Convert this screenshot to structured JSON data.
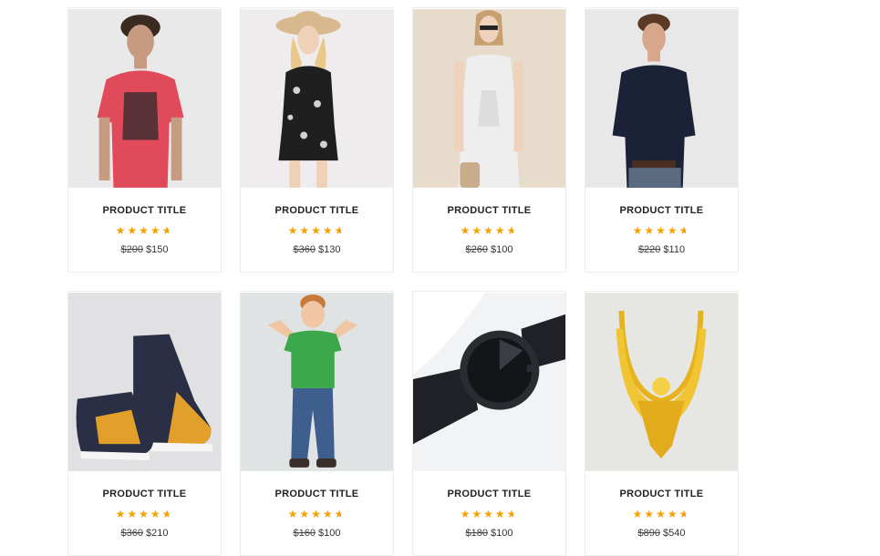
{
  "products": [
    {
      "title": "PRODUCT TITLE",
      "old_price": "$200",
      "price": "$150",
      "rating": 4.5,
      "image": "red-tshirt-man",
      "bg": "#e9e9ea"
    },
    {
      "title": "PRODUCT TITLE",
      "old_price": "$360",
      "price": "$130",
      "rating": 4.5,
      "image": "floral-romper-woman",
      "bg": "#eeecec"
    },
    {
      "title": "PRODUCT TITLE",
      "old_price": "$260",
      "price": "$100",
      "rating": 4.5,
      "image": "white-dress-woman",
      "bg": "#e7dccc"
    },
    {
      "title": "PRODUCT TITLE",
      "old_price": "$220",
      "price": "$110",
      "rating": 4.5,
      "image": "navy-shirt-man",
      "bg": "#e8e8e8"
    },
    {
      "title": "PRODUCT TITLE",
      "old_price": "$360",
      "price": "$210",
      "rating": 4.5,
      "image": "sneakers",
      "bg": "#e1e1e4"
    },
    {
      "title": "PRODUCT TITLE",
      "old_price": "$160",
      "price": "$100",
      "rating": 4.5,
      "image": "boy-green-shirt",
      "bg": "#dfe3e4"
    },
    {
      "title": "PRODUCT TITLE",
      "old_price": "$180",
      "price": "$100",
      "rating": 4.5,
      "image": "wrist-watch",
      "bg": "#f2f3f4"
    },
    {
      "title": "PRODUCT TITLE",
      "old_price": "$890",
      "price": "$540",
      "rating": 4.5,
      "image": "gold-necklace",
      "bg": "#e6e6e2"
    }
  ]
}
